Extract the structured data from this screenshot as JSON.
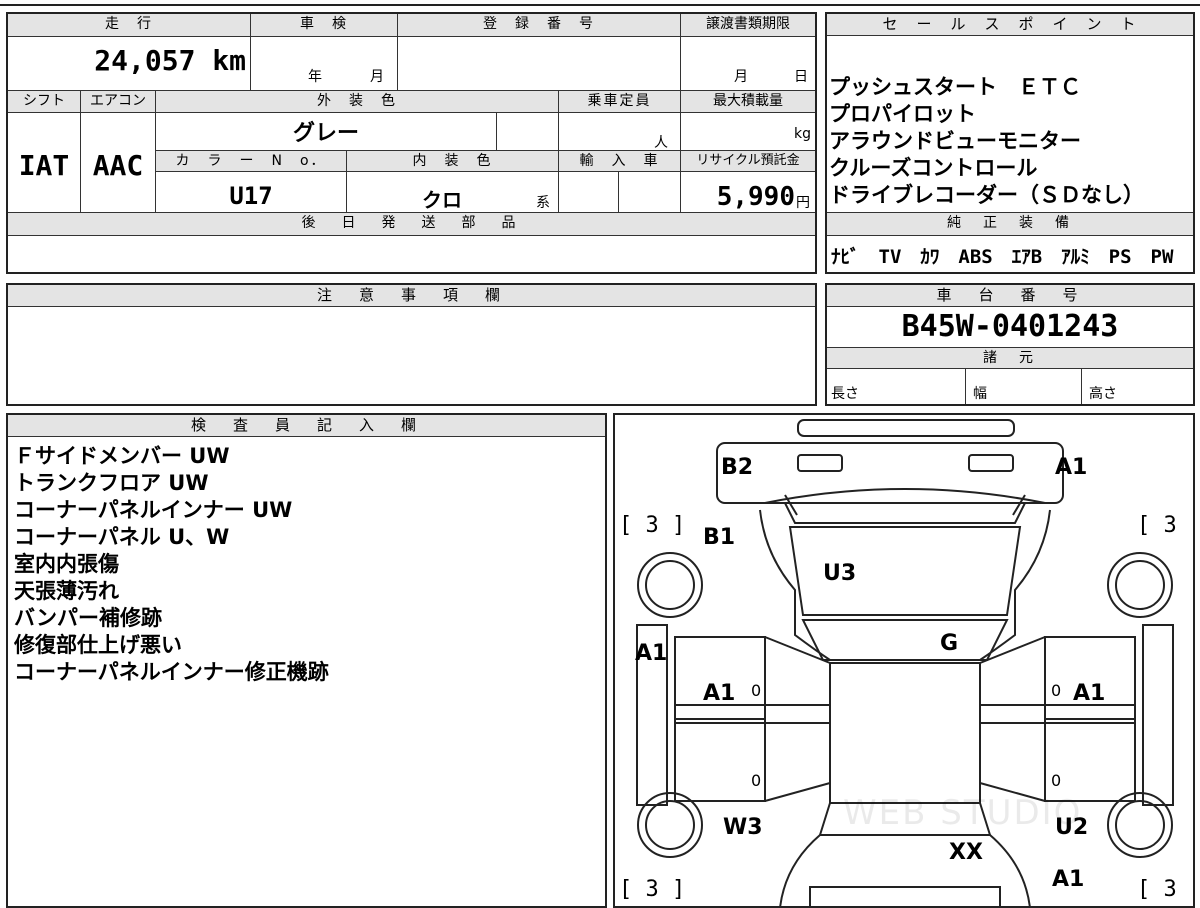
{
  "vehicle": {
    "mileage_label": "走　行",
    "mileage": "24,057 km",
    "shaken_label": "車　検",
    "shaken_year": "年",
    "shaken_month": "月",
    "reg_label": "登　録　番　号",
    "transfer_label": "譲渡書類期限",
    "transfer_month": "月",
    "transfer_day": "日",
    "shift_label": "シフト",
    "shift": "IAT",
    "ac_label": "エアコン",
    "ac": "AAC",
    "ext_color_label": "外　装　色",
    "ext_color": "グレー",
    "capacity_label": "乗車定員",
    "capacity_unit": "人",
    "max_load_label": "最大積載量",
    "max_load_unit": "kg",
    "color_no_label": "カ　ラ　ー　N　o．",
    "color_no": "U17",
    "int_color_label": "内　装　色",
    "int_color": "クロ",
    "int_color_suffix": "系",
    "import_label": "輸　入　車",
    "recycle_label": "リサイクル預託金",
    "recycle": "5,990",
    "recycle_unit": "円",
    "later_parts_label": "後　日　発　送　部　品"
  },
  "sales": {
    "label": "セ　ー　ル　ス　ポ　イ　ン　ト",
    "points": [
      "プッシュスタート　ＥＴＣ",
      "プロパイロット",
      "アラウンドビューモニター",
      "クルーズコントロール",
      "ドライブレコーダー（ＳＤなし）"
    ]
  },
  "genuine": {
    "label": "純　正　装　備",
    "items": "ﾅﾋﾞ　TV　ｶﾜ　ABS　ｴｱB　ｱﾙﾐ　PS　PW"
  },
  "notes": {
    "label": "注　意　事　項　欄"
  },
  "chassis": {
    "label": "車　台　番　号",
    "number": "B45W-0401243"
  },
  "specs": {
    "label": "諸　元",
    "length": "長さ",
    "width": "幅",
    "height": "高さ"
  },
  "inspector": {
    "label": "検　査　員　記　入　欄",
    "lines": [
      "Ｆサイドメンバー UW",
      "トランクフロア UW",
      "コーナーパネルインナー UW",
      "コーナーパネル U、W",
      "室内内張傷",
      "天張薄汚れ",
      "バンパー補修跡",
      "修復部仕上げ悪い",
      "コーナーパネルインナー修正機跡"
    ]
  },
  "diagram": {
    "labels": [
      "B2",
      "A1",
      "B1",
      "U3",
      "G",
      "A1",
      "A1",
      "A1",
      "A1",
      "W3",
      "U2",
      "XX",
      "A1"
    ],
    "tire": "[ 3 ]",
    "zero": "0",
    "watermark": "WEB STUDIO"
  }
}
